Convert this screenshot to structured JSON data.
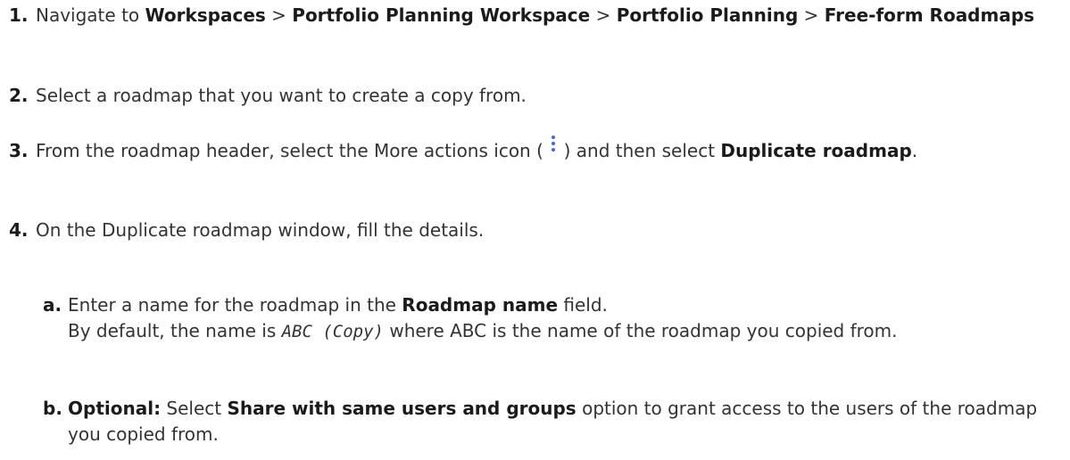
{
  "steps": [
    {
      "number": "1.",
      "parts": [
        {
          "t": "Navigate to "
        },
        {
          "t": "Workspaces",
          "b": true
        },
        {
          "t": " > "
        },
        {
          "t": "Portfolio Planning Workspace",
          "b": true
        },
        {
          "t": " > "
        },
        {
          "t": "Portfolio Planning",
          "b": true
        },
        {
          "t": " > "
        },
        {
          "t": "Free-form Roadmaps",
          "b": true
        }
      ]
    },
    {
      "number": "2.",
      "parts": [
        {
          "t": "Select a roadmap that you want to create a copy from."
        }
      ]
    },
    {
      "number": "3.",
      "parts": [
        {
          "t": "From the roadmap header, select the More actions icon ( "
        },
        {
          "icon": "more-actions-icon"
        },
        {
          "t": " ) and then select "
        },
        {
          "t": "Duplicate roadmap",
          "b": true
        },
        {
          "t": "."
        }
      ]
    },
    {
      "number": "4.",
      "parts": [
        {
          "t": "On the Duplicate roadmap window, fill the details."
        }
      ]
    }
  ],
  "substeps": [
    {
      "letter": "a.",
      "parts": [
        {
          "t": "Enter a name for the roadmap in the "
        },
        {
          "t": "Roadmap name",
          "b": true
        },
        {
          "t": " field."
        },
        {
          "br": true
        },
        {
          "t": "By default, the name is "
        },
        {
          "t": "ABC (Copy)",
          "code": true
        },
        {
          "t": " where ABC is the name of the roadmap you copied from."
        }
      ]
    },
    {
      "letter": "b.",
      "parts": [
        {
          "t": "Optional:",
          "b": true
        },
        {
          "t": "  Select "
        },
        {
          "t": "Share with same users and groups",
          "b": true
        },
        {
          "t": " option to grant access to the users of the roadmap you copied from."
        }
      ]
    }
  ],
  "colors": {
    "text": "#333333",
    "bold": "#1b1b1b",
    "icon": "#4a63e0"
  }
}
